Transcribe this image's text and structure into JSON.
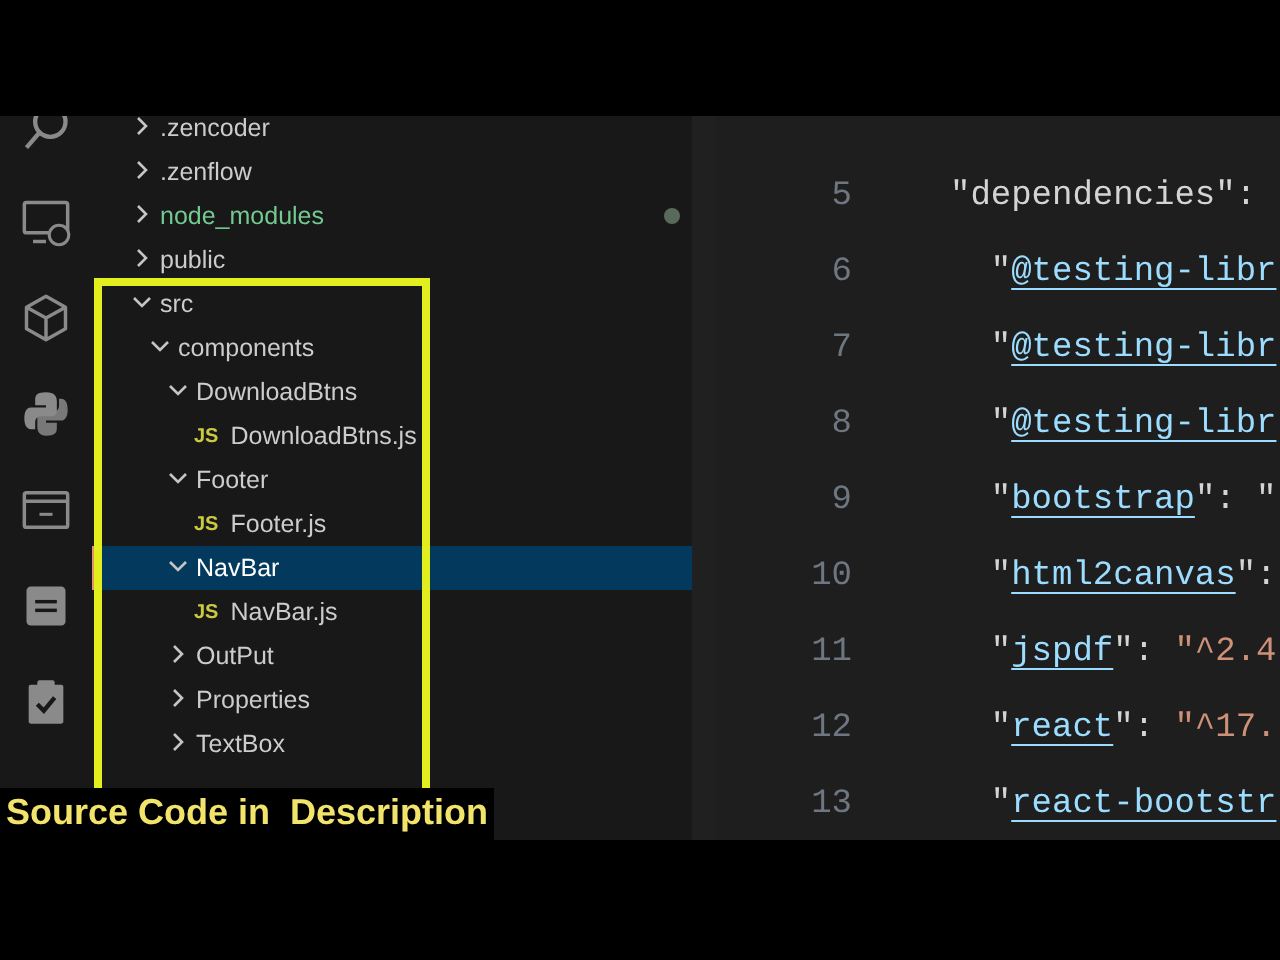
{
  "explorer": {
    "items": [
      {
        "name": ".zencoder",
        "kind": "folder",
        "expanded": false,
        "selected": false,
        "changed": false
      },
      {
        "name": ".zenflow",
        "kind": "folder",
        "expanded": false,
        "selected": false,
        "changed": false
      },
      {
        "name": "node_modules",
        "kind": "folder",
        "expanded": false,
        "selected": false,
        "changed": true
      },
      {
        "name": "public",
        "kind": "folder",
        "expanded": false,
        "selected": false,
        "changed": false
      },
      {
        "name": "src",
        "kind": "folder",
        "expanded": true,
        "selected": false,
        "changed": false,
        "children": [
          {
            "name": "components",
            "kind": "folder",
            "expanded": true,
            "selected": false,
            "changed": false,
            "children": [
              {
                "name": "DownloadBtns",
                "kind": "folder",
                "expanded": true,
                "selected": false,
                "changed": false,
                "children": [
                  {
                    "name": "DownloadBtns.js",
                    "kind": "file",
                    "badge": "JS",
                    "selected": false,
                    "changed": false
                  }
                ]
              },
              {
                "name": "Footer",
                "kind": "folder",
                "expanded": true,
                "selected": false,
                "changed": false,
                "children": [
                  {
                    "name": "Footer.js",
                    "kind": "file",
                    "badge": "JS",
                    "selected": false,
                    "changed": false
                  }
                ]
              },
              {
                "name": "NavBar",
                "kind": "folder",
                "expanded": true,
                "selected": true,
                "changed": false,
                "children": [
                  {
                    "name": "NavBar.js",
                    "kind": "file",
                    "badge": "JS",
                    "selected": false,
                    "changed": false
                  }
                ]
              },
              {
                "name": "OutPut",
                "kind": "folder",
                "expanded": false,
                "selected": false,
                "changed": false
              },
              {
                "name": "Properties",
                "kind": "folder",
                "expanded": false,
                "selected": false,
                "changed": false
              },
              {
                "name": "TextBox",
                "kind": "folder",
                "expanded": false,
                "selected": false,
                "changed": false
              }
            ]
          }
        ]
      }
    ]
  },
  "editor": {
    "lines": [
      {
        "number": "5",
        "tokens": [
          {
            "kind": "plain",
            "text": "\"dependencies\":"
          }
        ]
      },
      {
        "number": "6",
        "tokens": [
          {
            "kind": "plain",
            "text": "  \""
          },
          {
            "kind": "key",
            "text": "@testing-libr"
          }
        ]
      },
      {
        "number": "7",
        "tokens": [
          {
            "kind": "plain",
            "text": "  \""
          },
          {
            "kind": "key",
            "text": "@testing-libr"
          }
        ]
      },
      {
        "number": "8",
        "tokens": [
          {
            "kind": "plain",
            "text": "  \""
          },
          {
            "kind": "key",
            "text": "@testing-libr"
          }
        ]
      },
      {
        "number": "9",
        "tokens": [
          {
            "kind": "plain",
            "text": "  \""
          },
          {
            "kind": "key",
            "text": "bootstrap"
          },
          {
            "kind": "plain",
            "text": "\": \""
          }
        ]
      },
      {
        "number": "10",
        "tokens": [
          {
            "kind": "plain",
            "text": "  \""
          },
          {
            "kind": "key",
            "text": "html2canvas"
          },
          {
            "kind": "plain",
            "text": "\":"
          }
        ]
      },
      {
        "number": "11",
        "tokens": [
          {
            "kind": "plain",
            "text": "  \""
          },
          {
            "kind": "key",
            "text": "jspdf"
          },
          {
            "kind": "plain",
            "text": "\": "
          },
          {
            "kind": "string",
            "text": "\"^2.4"
          }
        ]
      },
      {
        "number": "12",
        "tokens": [
          {
            "kind": "plain",
            "text": "  \""
          },
          {
            "kind": "key",
            "text": "react"
          },
          {
            "kind": "plain",
            "text": "\": "
          },
          {
            "kind": "string",
            "text": "\"^17."
          }
        ]
      },
      {
        "number": "13",
        "tokens": [
          {
            "kind": "plain",
            "text": "  \""
          },
          {
            "kind": "key",
            "text": "react-bootstr"
          }
        ]
      }
    ]
  },
  "overlay": {
    "caption": "Source Code in  Description"
  }
}
